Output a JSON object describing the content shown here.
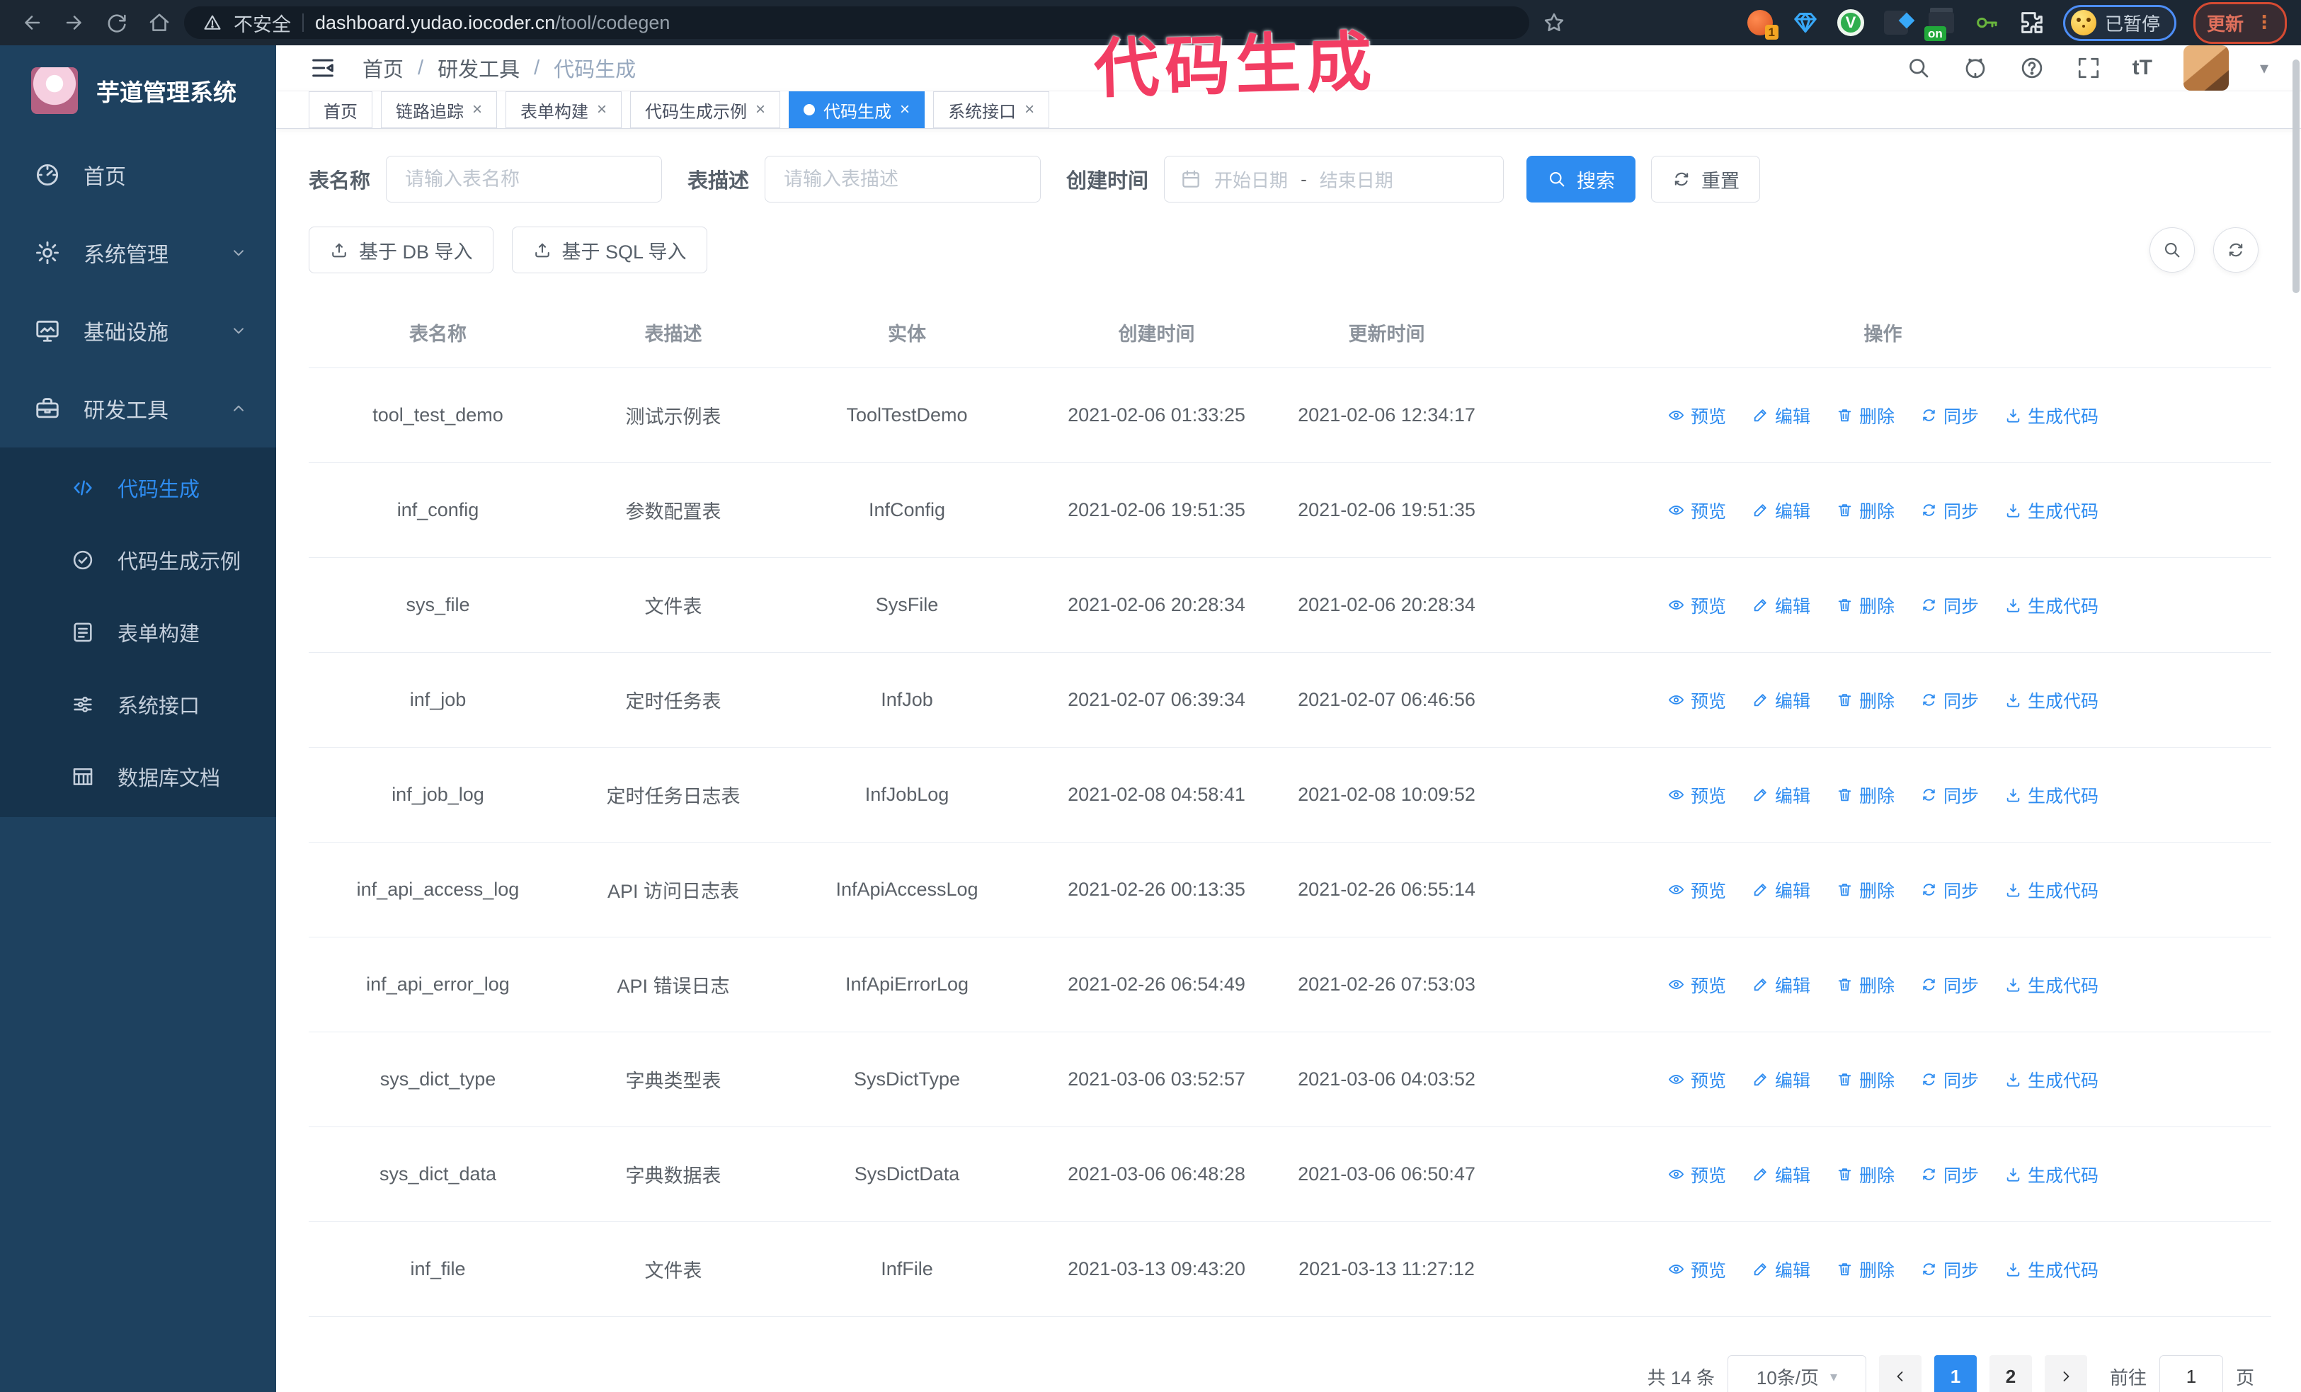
{
  "colors": {
    "accent": "#2e8cf0",
    "sidebar": "#1e415f",
    "submenu": "#16334c",
    "annotation": "#f23d63"
  },
  "annotation": {
    "text": "代码生成"
  },
  "browser": {
    "insecure_label": "不安全",
    "url_host": "dashboard.yudao.iocoder.cn",
    "url_path": "/tool/codegen",
    "ext_badge_1": "1",
    "ext_badge_on": "on",
    "ext_green_letter": "V",
    "paused_label": "已暂停",
    "update_label": "更新",
    "menu_dots": "⋮"
  },
  "sidebar": {
    "app_title": "芋道管理系统",
    "items": [
      {
        "label": "首页",
        "icon": "dashboard",
        "chevron": null,
        "active": false
      },
      {
        "label": "系统管理",
        "icon": "gear",
        "chevron": "down",
        "active": false
      },
      {
        "label": "基础设施",
        "icon": "monitor",
        "chevron": "down",
        "active": false
      },
      {
        "label": "研发工具",
        "icon": "toolbox",
        "chevron": "up",
        "active": false
      }
    ],
    "submenu": [
      {
        "label": "代码生成",
        "icon": "code",
        "active": true
      },
      {
        "label": "代码生成示例",
        "icon": "badge-check",
        "active": false
      },
      {
        "label": "表单构建",
        "icon": "form",
        "active": false
      },
      {
        "label": "系统接口",
        "icon": "sliders",
        "active": false
      },
      {
        "label": "数据库文档",
        "icon": "db-table",
        "active": false
      }
    ]
  },
  "header": {
    "breadcrumb": [
      "首页",
      "研发工具",
      "代码生成"
    ],
    "separator": "/",
    "font_icon_text": "tT",
    "caret": "▾"
  },
  "tabs": [
    {
      "label": "首页",
      "closable": false,
      "active": false
    },
    {
      "label": "链路追踪",
      "closable": true,
      "active": false
    },
    {
      "label": "表单构建",
      "closable": true,
      "active": false
    },
    {
      "label": "代码生成示例",
      "closable": true,
      "active": false
    },
    {
      "label": "代码生成",
      "closable": true,
      "active": true
    },
    {
      "label": "系统接口",
      "closable": true,
      "active": false
    }
  ],
  "filters": {
    "name_label": "表名称",
    "name_placeholder": "请输入表名称",
    "desc_label": "表描述",
    "desc_placeholder": "请输入表描述",
    "time_label": "创建时间",
    "date_start": "开始日期",
    "date_sep": "-",
    "date_end": "结束日期",
    "search_label": "搜索",
    "reset_label": "重置"
  },
  "toolbar": {
    "db_import_label": "基于 DB 导入",
    "sql_import_label": "基于 SQL 导入"
  },
  "table": {
    "columns": [
      "表名称",
      "表描述",
      "实体",
      "创建时间",
      "更新时间",
      "操作"
    ],
    "row_actions": [
      {
        "label": "预览",
        "icon": "eye"
      },
      {
        "label": "编辑",
        "icon": "edit"
      },
      {
        "label": "删除",
        "icon": "delete"
      },
      {
        "label": "同步",
        "icon": "sync"
      },
      {
        "label": "生成代码",
        "icon": "download"
      }
    ],
    "rows": [
      {
        "name": "tool_test_demo",
        "desc": "测试示例表",
        "entity": "ToolTestDemo",
        "created": "2021-02-06 01:33:25",
        "updated": "2021-02-06 12:34:17"
      },
      {
        "name": "inf_config",
        "desc": "参数配置表",
        "entity": "InfConfig",
        "created": "2021-02-06 19:51:35",
        "updated": "2021-02-06 19:51:35"
      },
      {
        "name": "sys_file",
        "desc": "文件表",
        "entity": "SysFile",
        "created": "2021-02-06 20:28:34",
        "updated": "2021-02-06 20:28:34"
      },
      {
        "name": "inf_job",
        "desc": "定时任务表",
        "entity": "InfJob",
        "created": "2021-02-07 06:39:34",
        "updated": "2021-02-07 06:46:56"
      },
      {
        "name": "inf_job_log",
        "desc": "定时任务日志表",
        "entity": "InfJobLog",
        "created": "2021-02-08 04:58:41",
        "updated": "2021-02-08 10:09:52"
      },
      {
        "name": "inf_api_access_log",
        "desc": "API 访问日志表",
        "entity": "InfApiAccessLog",
        "created": "2021-02-26 00:13:35",
        "updated": "2021-02-26 06:55:14"
      },
      {
        "name": "inf_api_error_log",
        "desc": "API 错误日志",
        "entity": "InfApiErrorLog",
        "created": "2021-02-26 06:54:49",
        "updated": "2021-02-26 07:53:03"
      },
      {
        "name": "sys_dict_type",
        "desc": "字典类型表",
        "entity": "SysDictType",
        "created": "2021-03-06 03:52:57",
        "updated": "2021-03-06 04:03:52"
      },
      {
        "name": "sys_dict_data",
        "desc": "字典数据表",
        "entity": "SysDictData",
        "created": "2021-03-06 06:48:28",
        "updated": "2021-03-06 06:50:47"
      },
      {
        "name": "inf_file",
        "desc": "文件表",
        "entity": "InfFile",
        "created": "2021-03-13 09:43:20",
        "updated": "2021-03-13 11:27:12"
      }
    ]
  },
  "pagination": {
    "total_label": "共 14 条",
    "page_size_label": "10条/页",
    "pages": [
      "1",
      "2"
    ],
    "active_page": "1",
    "goto_label": "前往",
    "goto_value": "1",
    "goto_unit": "页"
  }
}
